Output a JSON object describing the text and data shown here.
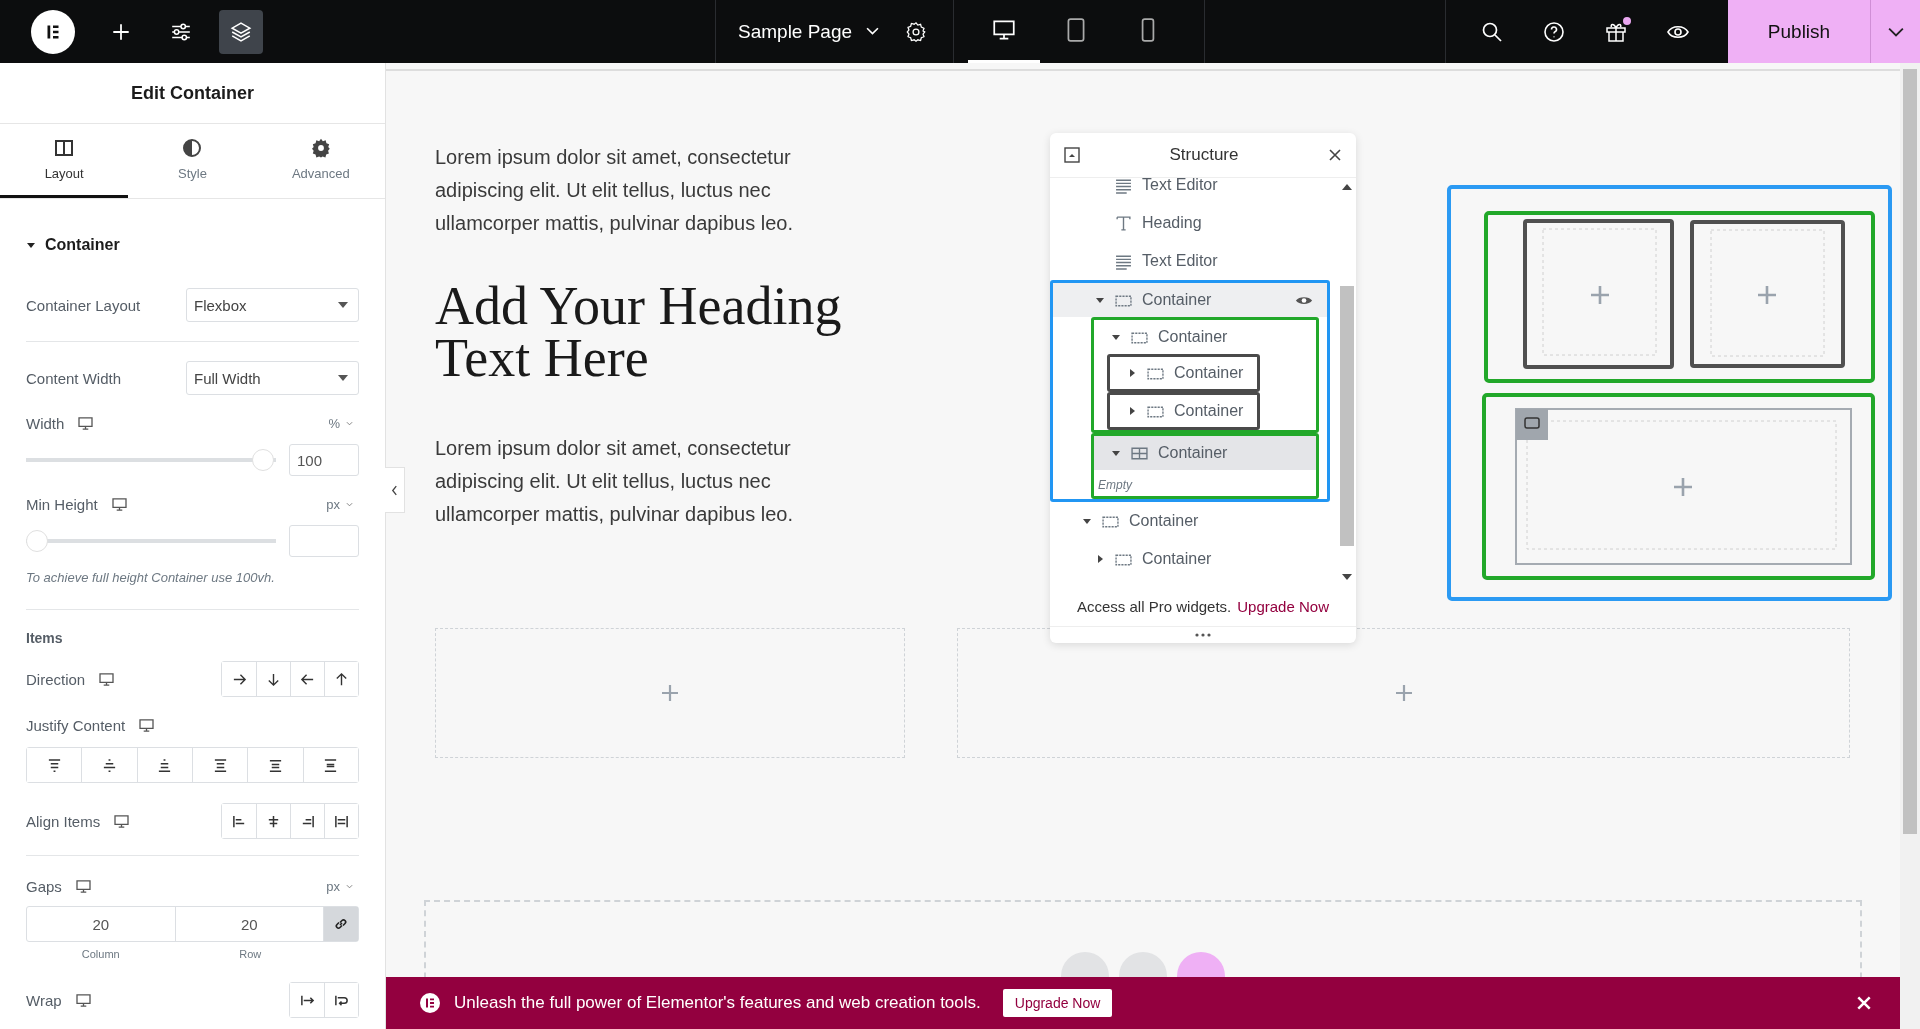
{
  "topbar": {
    "tools": [
      {
        "kind": "add",
        "selected": false
      },
      {
        "kind": "settings",
        "selected": false
      },
      {
        "kind": "layers",
        "selected": true
      }
    ],
    "page_title": "Sample Page",
    "devices": [
      {
        "kind": "desktop",
        "selected": true
      },
      {
        "kind": "tablet",
        "selected": false
      },
      {
        "kind": "mobile",
        "selected": false
      }
    ],
    "actions": [
      {
        "kind": "search",
        "badge": false
      },
      {
        "kind": "help",
        "badge": false
      },
      {
        "kind": "gift",
        "badge": true
      },
      {
        "kind": "preview",
        "badge": false
      }
    ],
    "publish": "Publish"
  },
  "panel": {
    "title": "Edit Container",
    "tabs": [
      {
        "kind": "layout",
        "label": "Layout",
        "selected": true
      },
      {
        "kind": "style",
        "label": "Style",
        "selected": false
      },
      {
        "kind": "advanced",
        "label": "Advanced",
        "selected": false
      }
    ],
    "section": {
      "label": "Container",
      "expanded": true
    },
    "container_layout": {
      "label": "Container Layout",
      "value": "Flexbox"
    },
    "content_width": {
      "label": "Content Width",
      "value": "Full Width"
    },
    "width": {
      "label": "Width",
      "unit": "%",
      "level": 1,
      "value": "100"
    },
    "min_height": {
      "label": "Min Height",
      "unit": "px",
      "level": 0
    },
    "note": "To achieve full height Container use 100vh.",
    "items_heading": "Items",
    "direction": {
      "label": "Direction"
    },
    "justify": {
      "label": "Justify Content"
    },
    "align": {
      "label": "Align Items"
    },
    "gaps": {
      "label": "Gaps",
      "unit": "px",
      "column": "20",
      "row": "20",
      "column_label": "Column",
      "row_label": "Row",
      "linked": true
    },
    "wrap": {
      "label": "Wrap"
    }
  },
  "canvas": {
    "widgets": [
      {
        "kind": "text",
        "text": "Lorem ipsum dolor sit amet, consectetur adipiscing elit. Ut elit tellus, luctus nec ullamcorper mattis, pulvinar dapibus leo."
      },
      {
        "kind": "heading",
        "text": "Add Your Heading Text Here"
      },
      {
        "kind": "text",
        "text": "Lorem ipsum dolor sit amet, consectetur adipiscing elit. Ut elit tellus, luctus nec ullamcorper mattis, pulvinar dapibus leo."
      }
    ]
  },
  "structure": {
    "title": "Structure",
    "tree": [
      {
        "children": [
          {
            "kind": "text",
            "label": "Text Editor",
            "selected": false,
            "hovered": false
          },
          {
            "kind": "heading",
            "label": "Heading",
            "selected": false,
            "hovered": false
          },
          {
            "kind": "text",
            "label": "Text Editor",
            "selected": false,
            "hovered": false
          },
          {
            "kind": "container",
            "label": "Container",
            "expanded": true,
            "selected": false,
            "hovered": true,
            "color": "#2196f3",
            "children": [
              {
                "kind": "container",
                "label": "Container",
                "expanded": true,
                "selected": false,
                "hovered": false,
                "color": "#22a82a",
                "children": [
                  {
                    "kind": "container",
                    "label": "Container",
                    "expanded": false,
                    "selected": false,
                    "hovered": false,
                    "color": "#4a4a4a"
                  },
                  {
                    "kind": "container",
                    "label": "Container",
                    "expanded": false,
                    "selected": false,
                    "hovered": false,
                    "color": "#4a4a4a"
                  }
                ]
              },
              {
                "kind": "grid",
                "label": "Container",
                "expanded": true,
                "selected": true,
                "hovered": false,
                "color": "#22a82a",
                "empty_note": "Empty"
              }
            ]
          }
        ]
      },
      {
        "kind": "container",
        "label": "Container",
        "expanded": true,
        "selected": false,
        "hovered": false,
        "children": [
          {
            "kind": "container",
            "label": "Container",
            "expanded": false,
            "selected": false,
            "hovered": false
          }
        ]
      }
    ],
    "promo": "Access all Pro widgets.",
    "promo_link": "Upgrade Now"
  },
  "banner": {
    "text": "Unleash the full power of Elementor's features and web creation tools.",
    "button": "Upgrade Now"
  }
}
